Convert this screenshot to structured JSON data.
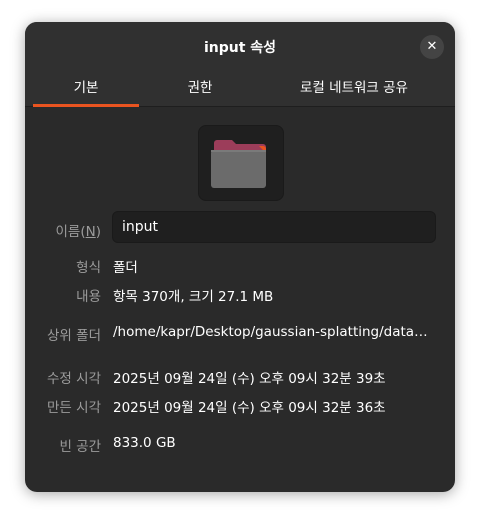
{
  "window": {
    "title": "input 속성",
    "close_label": "✕"
  },
  "tabs": [
    {
      "label": "기본",
      "active": true
    },
    {
      "label": "권한",
      "active": false
    },
    {
      "label": "로컬 네트워크 공유",
      "active": false
    }
  ],
  "icon": {
    "name": "folder-icon",
    "colors": {
      "back": "#9c3d5a",
      "front": "#6b6b6b",
      "edge": "#e95420"
    }
  },
  "fields": {
    "name_label_prefix": "이름(",
    "name_label_mnemonic": "N",
    "name_label_suffix": ")",
    "name_value": "input",
    "type_label": "형식",
    "type_value": "폴더",
    "contents_label": "내용",
    "contents_value": "항목 370개, 크기 27.1 MB",
    "parent_label": "상위 폴더",
    "parent_value": "/home/kapr/Desktop/gaussian-splatting/data…",
    "modified_label": "수정 시각",
    "modified_value": "2025년 09월 24일 (수) 오후 09시 32분 39초",
    "created_label": "만든 시각",
    "created_value": "2025년 09월 24일 (수) 오후 09시 32분 36초",
    "free_label": "빈 공간",
    "free_value": "833.0 GB"
  },
  "colors": {
    "accent": "#e95420",
    "background": "#2a2a2a",
    "header": "#303030"
  }
}
